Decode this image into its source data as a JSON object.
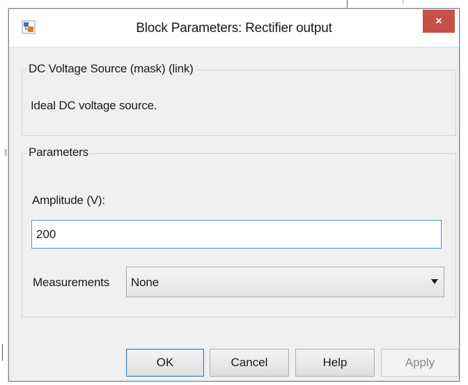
{
  "window": {
    "title": "Block Parameters: Rectifier output",
    "close_label": "×"
  },
  "description_group": {
    "legend": "DC Voltage Source (mask) (link)",
    "text": "Ideal DC voltage source."
  },
  "parameters_group": {
    "legend": "Parameters",
    "amplitude_label": "Amplitude (V):",
    "amplitude_value": "200",
    "measurements_label": "Measurements",
    "measurements_selected": "None"
  },
  "buttons": {
    "ok": "OK",
    "cancel": "Cancel",
    "help": "Help",
    "apply": "Apply"
  },
  "icons": {
    "app": "simulink-block-icon",
    "close": "close-icon",
    "dropdown": "chevron-down-icon"
  },
  "colors": {
    "close_button": "#c7504a",
    "input_focus_border": "#4a90d9",
    "dialog_background": "#f0f0f0"
  }
}
